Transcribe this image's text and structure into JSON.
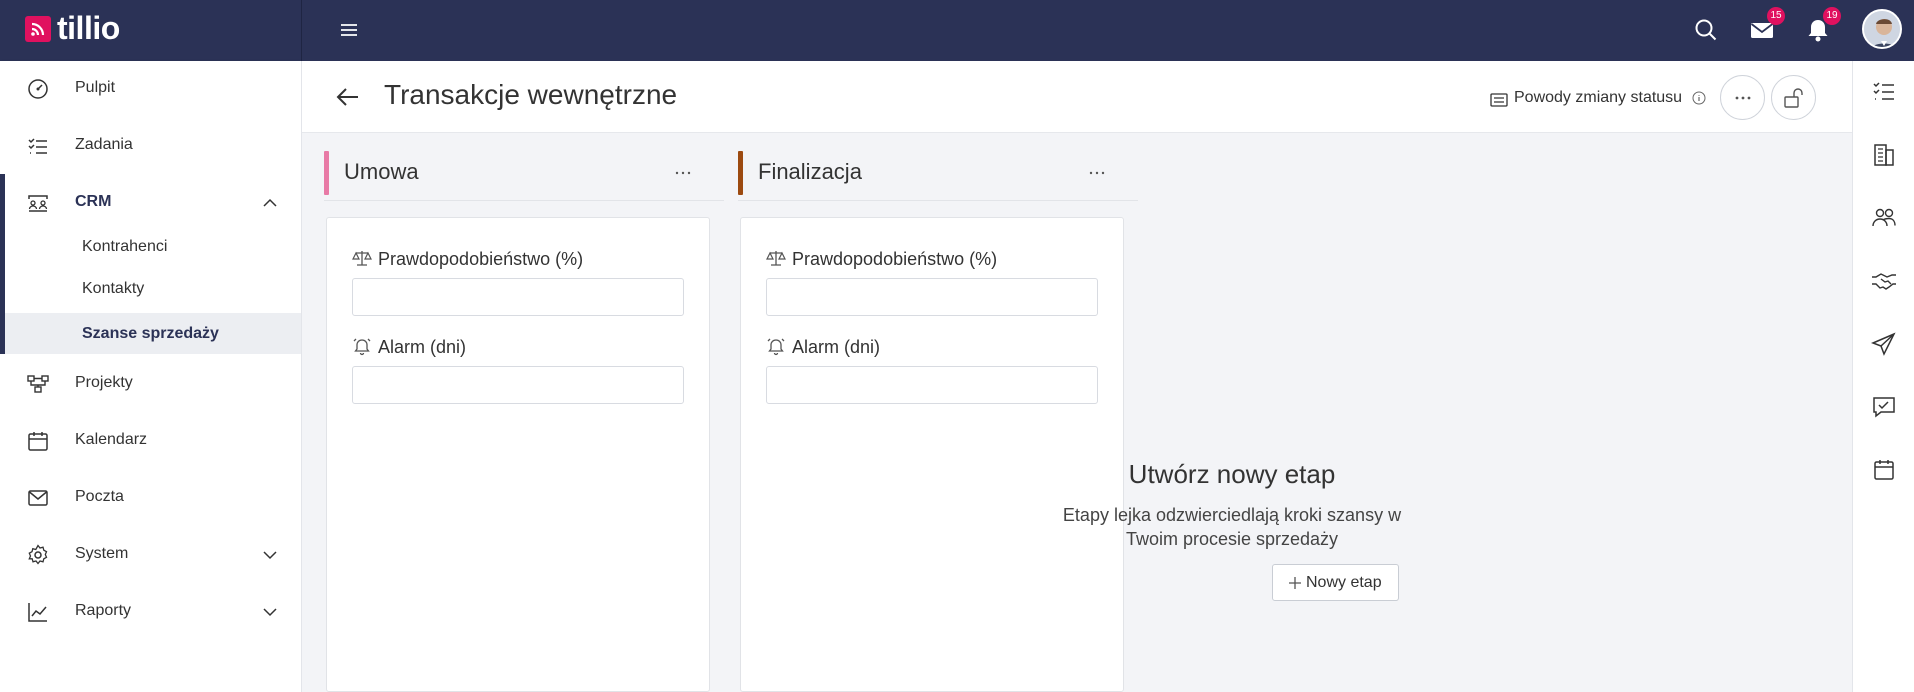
{
  "app": {
    "logo_text": "tillio"
  },
  "topbar": {
    "hamburger_icon": "menu-icon",
    "search_icon": "search-icon",
    "mail_icon": "mail-icon",
    "mail_badge": "15",
    "bell_icon": "bell-icon",
    "bell_badge": "19",
    "accent_color": "#e0115f",
    "bar_color": "#2b3256"
  },
  "sidebar": {
    "items": [
      {
        "label": "Pulpit",
        "icon": "dashboard-icon"
      },
      {
        "label": "Zadania",
        "icon": "tasks-icon"
      },
      {
        "label": "CRM",
        "icon": "crm-icon",
        "expanded": true
      },
      {
        "label": "Projekty",
        "icon": "projects-icon"
      },
      {
        "label": "Kalendarz",
        "icon": "calendar-icon"
      },
      {
        "label": "Poczta",
        "icon": "mail-icon"
      },
      {
        "label": "System",
        "icon": "gear-icon",
        "expandable": true
      },
      {
        "label": "Raporty",
        "icon": "chart-icon",
        "expandable": true
      }
    ],
    "crm_sub": [
      {
        "label": "Kontrahenci"
      },
      {
        "label": "Kontakty"
      },
      {
        "label": "Szanse sprzedaży",
        "active": true
      }
    ]
  },
  "header": {
    "title": "Transakcje wewnętrzne",
    "reasons_label": "Powody zmiany statusu"
  },
  "columns": [
    {
      "name": "Umowa",
      "color": "#e87aa6",
      "fields": [
        {
          "label": "Prawdopodobieństwo (%)",
          "icon": "scale-icon",
          "value": ""
        },
        {
          "label": "Alarm (dni)",
          "icon": "alarm-icon",
          "value": ""
        }
      ]
    },
    {
      "name": "Finalizacja",
      "color": "#9c4a10",
      "fields": [
        {
          "label": "Prawdopodobieństwo (%)",
          "icon": "scale-icon",
          "value": ""
        },
        {
          "label": "Alarm (dni)",
          "icon": "alarm-icon",
          "value": ""
        }
      ]
    }
  ],
  "empty_state": {
    "title": "Utwórz nowy etap",
    "description": "Etapy lejka odzwierciedlają kroki szansy w Twoim procesie sprzedaży",
    "button_label": "Nowy etap"
  },
  "rail": [
    "tasks-icon",
    "contractors-icon",
    "contacts-icon",
    "deals-icon",
    "send-icon",
    "chat-check-icon",
    "calendar-icon"
  ]
}
